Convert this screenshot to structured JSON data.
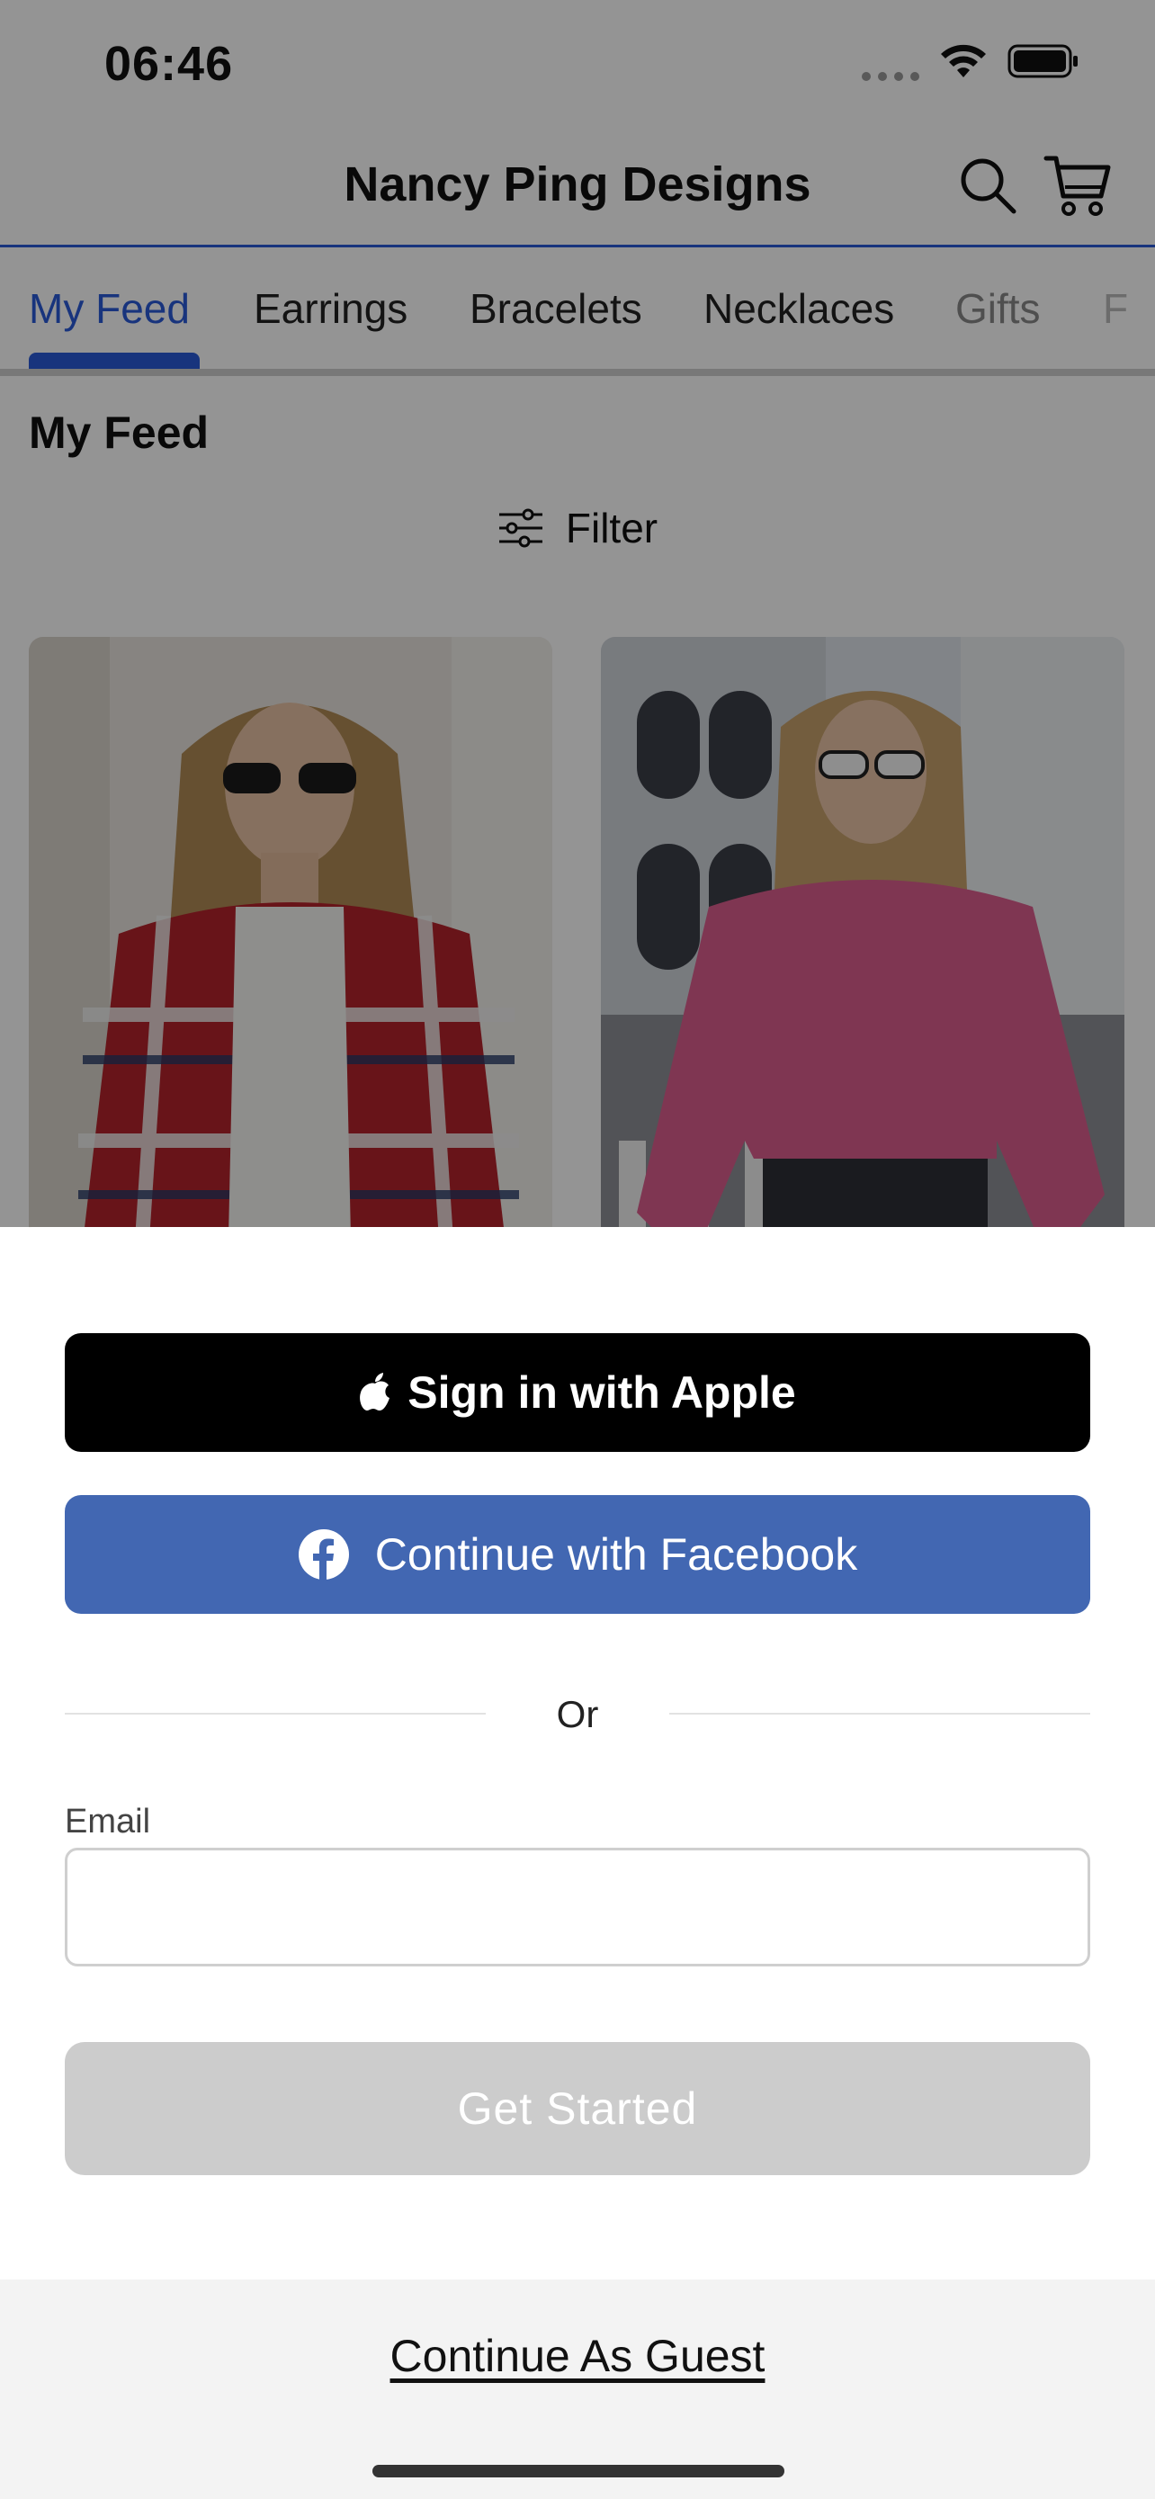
{
  "status_bar": {
    "time": "06:46"
  },
  "header": {
    "title": "Nancy Ping Designs",
    "search_icon": "search-icon",
    "cart_icon": "cart-icon"
  },
  "tabs": [
    {
      "label": "My Feed",
      "active": true
    },
    {
      "label": "Earrings"
    },
    {
      "label": "Bracelets"
    },
    {
      "label": "Necklaces"
    },
    {
      "label": "Gifts"
    },
    {
      "label": "F"
    }
  ],
  "feed": {
    "title": "My Feed",
    "filter_label": "Filter"
  },
  "sheet": {
    "apple_button": "Sign in with Apple",
    "facebook_button": "Continue with Facebook",
    "divider_text": "Or",
    "email_label": "Email",
    "email_value": "",
    "get_started": "Get Started",
    "guest_link": "Continue As Guest"
  },
  "colors": {
    "accent": "#2a5bd7",
    "facebook": "#4267b2",
    "apple": "#000000",
    "disabled_button": "#cccccc"
  }
}
